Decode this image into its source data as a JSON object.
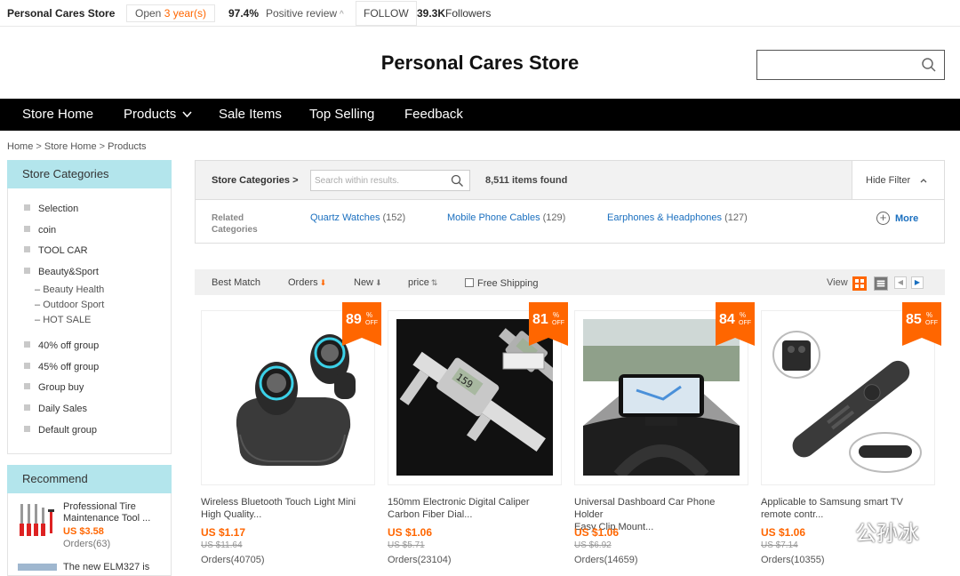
{
  "topbar": {
    "store_name": "Personal Cares Store",
    "open_prefix": "Open",
    "open_years": "3 year(s)",
    "positive_pct": "97.4%",
    "positive_label": "Positive review",
    "follow_label": "FOLLOW",
    "followers_count": "39.3K",
    "followers_label": "Followers"
  },
  "header": {
    "title": "Personal Cares Store",
    "search_value": ""
  },
  "nav": {
    "items": [
      "Store Home",
      "Products",
      "Sale Items",
      "Top Selling",
      "Feedback"
    ]
  },
  "breadcrumb": [
    "Home",
    "Store Home",
    "Products"
  ],
  "sidebar": {
    "categories_title": "Store Categories",
    "categories": [
      "Selection",
      "coin",
      "TOOL CAR",
      "Beauty&Sport",
      "40% off group",
      "45% off group",
      "Group buy",
      "Daily Sales",
      "Default group"
    ],
    "subcategories": [
      "Beauty Health",
      "Outdoor Sport",
      "HOT SALE"
    ],
    "recommend_title": "Recommend",
    "recommend": [
      {
        "title_line1": "Professional Tire",
        "title_line2": "Maintenance Tool ...",
        "price": "US $3.58",
        "orders": "Orders(63)"
      },
      {
        "title_line1": "The new ELM327 is"
      }
    ]
  },
  "filter": {
    "store_categories": "Store Categories >",
    "search_placeholder": "Search within results.",
    "items_found": "8,511 items found",
    "hide_filter": "Hide Filter",
    "related_label_1": "Related",
    "related_label_2": "Categories",
    "related": [
      {
        "name": "Quartz Watches",
        "count": "(152)"
      },
      {
        "name": "Mobile Phone Cables",
        "count": "(129)"
      },
      {
        "name": "Earphones & Headphones",
        "count": "(127)"
      }
    ],
    "more": "More"
  },
  "sort": {
    "best_match": "Best Match",
    "orders": "Orders",
    "new": "New",
    "price": "price",
    "free_shipping": "Free Shipping",
    "view": "View"
  },
  "products": [
    {
      "discount": "89",
      "title_1": "Wireless Bluetooth Touch Light Mini",
      "title_2": "High Quality...",
      "price": "US $1.17",
      "old_price": "US $11.64",
      "orders": "Orders(40705)"
    },
    {
      "discount": "81",
      "title_1": "150mm Electronic Digital Caliper",
      "title_2": "Carbon Fiber Dial...",
      "price": "US $1.06",
      "old_price": "US $5.71",
      "orders": "Orders(23104)"
    },
    {
      "discount": "84",
      "title_1": "Universal Dashboard Car Phone Holder",
      "title_2": "Easy Clip Mount...",
      "price": "US $1.06",
      "old_price": "US $6.92",
      "orders": "Orders(14659)"
    },
    {
      "discount": "85",
      "title_1": "Applicable to Samsung smart TV",
      "title_2": "remote contr...",
      "price": "US $1.06",
      "old_price": "US $7.14",
      "orders": "Orders(10355)"
    }
  ],
  "badge": {
    "percent": "%",
    "off": "OFF"
  },
  "watermark": "公孙冰",
  "colors": {
    "accent": "#ff6600",
    "nav_bg": "#000000",
    "sidebar_head": "#b3e5ec",
    "link": "#1a6fbf"
  }
}
